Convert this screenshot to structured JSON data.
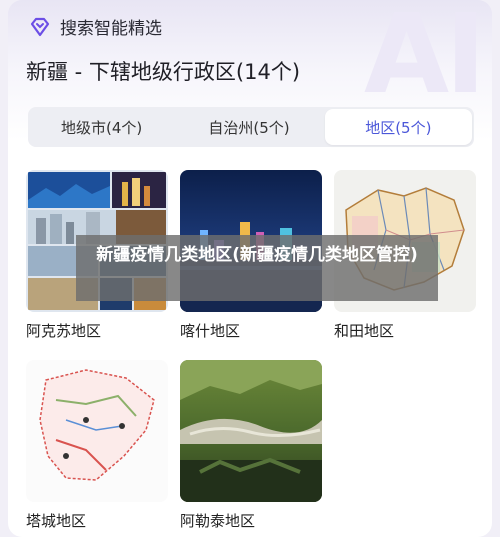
{
  "brand": "搜索智能精选",
  "watermark": "AI",
  "title": "新疆 - 下辖地级行政区(14个)",
  "tabs": [
    {
      "label": "地级市(4个)",
      "active": false
    },
    {
      "label": "自治州(5个)",
      "active": false
    },
    {
      "label": "地区(5个)",
      "active": true
    }
  ],
  "items": [
    {
      "label": "阿克苏地区",
      "icon": "aksu-city-collage-image"
    },
    {
      "label": "喀什地区",
      "icon": "kashgar-night-skyline-image"
    },
    {
      "label": "和田地区",
      "icon": "hotan-map-image"
    },
    {
      "label": "塔城地区",
      "icon": "tacheng-map-image"
    },
    {
      "label": "阿勒泰地区",
      "icon": "altay-landscape-image"
    }
  ],
  "overlay_text": "新疆疫情几类地区(新疆疫情几类地区管控)",
  "colors": {
    "accent": "#4b57d9",
    "tab_bg": "#edeef3"
  }
}
